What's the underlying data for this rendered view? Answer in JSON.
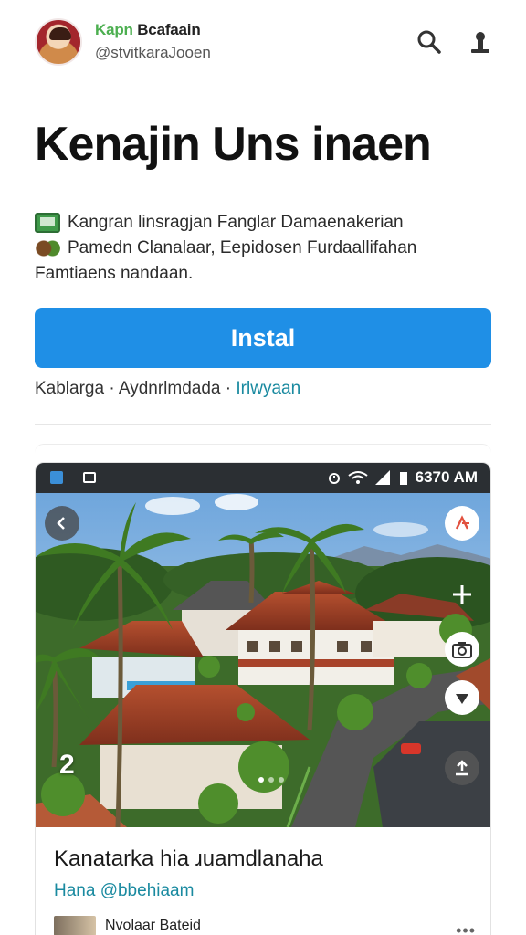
{
  "header": {
    "user_name_part1": "Kapn",
    "user_name_part2": "Bcafaain",
    "user_handle": "@stvitkaraJooen",
    "icons": {
      "search": "search-icon",
      "profile": "person-icon"
    }
  },
  "app": {
    "title": "Kenajin Uns inaen",
    "description_lines": [
      "Kangran linsragjan Fanglar Damaenakerian",
      "Pamedn Clanalaar, Eepidosen Furdaallifahan",
      "Famtiaens nandaan."
    ],
    "install_label": "Instal",
    "meta_part1": "Kablarga · Aydnrlmdada · ",
    "meta_link": "Irlwyaan"
  },
  "screenshot": {
    "status_time": "6370 AM",
    "counter": "2",
    "post_title": "Kanatarka hia ɹuamdlanaha",
    "post_handle": "Hana @bbehiaam",
    "author_name": "Nvolaar Bateid",
    "more_label": "•••"
  },
  "colors": {
    "accent": "#1f8fe6",
    "link": "#1a8aa0",
    "green": "#4caf50"
  }
}
